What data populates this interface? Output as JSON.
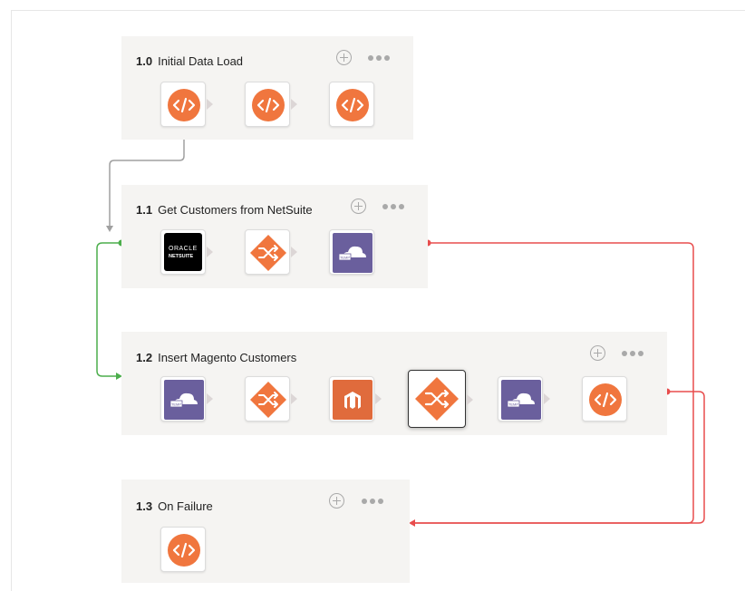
{
  "colors": {
    "panel": "#f5f4f2",
    "orange": "#f0763e",
    "purple": "#6a5f9d",
    "magento": "#e06b3c",
    "success_line": "#4cae4c",
    "failure_line": "#e84d4d",
    "flow_line": "#a0a0a0"
  },
  "operations": [
    {
      "number": "1.0",
      "name": "Initial Data Load",
      "steps": [
        {
          "icon": "script-icon"
        },
        {
          "icon": "script-icon"
        },
        {
          "icon": "script-icon"
        }
      ]
    },
    {
      "number": "1.1",
      "name": "Get Customers from NetSuite",
      "steps": [
        {
          "icon": "netsuite-icon",
          "label_line1": "ORACLE",
          "label_line2": "NETSUITE"
        },
        {
          "icon": "transformation-icon"
        },
        {
          "icon": "temp-storage-icon",
          "label": "TEMP"
        }
      ]
    },
    {
      "number": "1.2",
      "name": "Insert Magento Customers",
      "steps": [
        {
          "icon": "temp-storage-icon",
          "label": "TEMP"
        },
        {
          "icon": "transformation-icon"
        },
        {
          "icon": "magento-icon"
        },
        {
          "icon": "transformation-icon",
          "selected": true
        },
        {
          "icon": "temp-storage-icon",
          "label": "TEMP"
        },
        {
          "icon": "script-icon"
        }
      ]
    },
    {
      "number": "1.3",
      "name": "On Failure",
      "steps": [
        {
          "icon": "script-icon"
        }
      ]
    }
  ]
}
